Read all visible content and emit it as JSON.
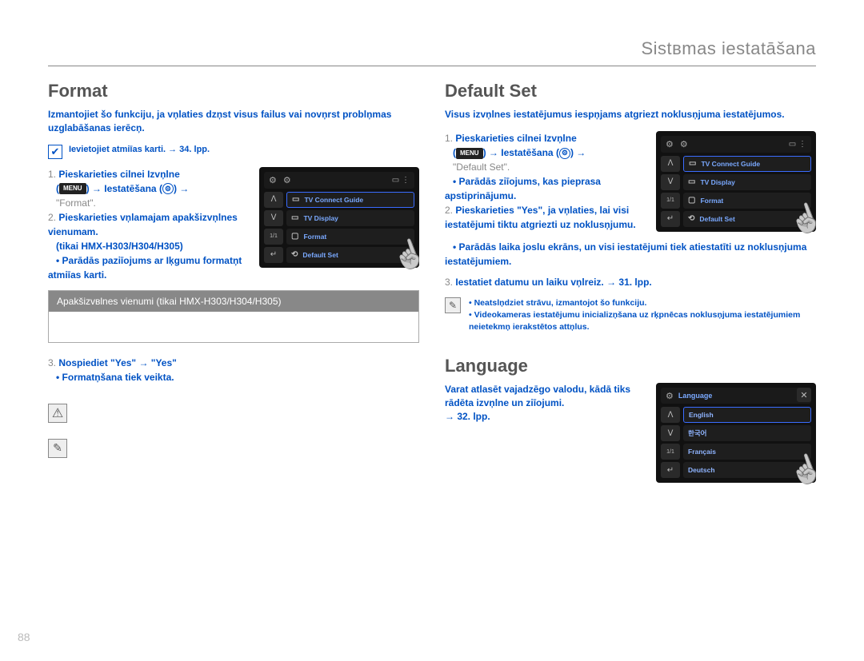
{
  "header": {
    "title": "Sistвmas iestatāšana"
  },
  "page_number": "88",
  "left": {
    "format": {
      "title": "Format",
      "intro": "Izmantojiet šo funkciju, ja vņlaties dzņst visus failus vai novņrst problņmas uzglabāšanas ierēcņ.",
      "precheck": "Ievietojiet atmiīas karti. → 34. lpp.",
      "step1_num": "1.",
      "step1": "Pieskarieties cilnei Izvņlne",
      "step1_b": "Iestatēšana (",
      "step1_c": ") →",
      "step1_format": "\"Format\".",
      "step2_num": "2.",
      "step2": "Pieskarieties vņlamajam apakšizvņlnes vienumam.",
      "step2_only": "(tikai HMX-H303/H304/H305)",
      "step2_li1": "Parādās paziīojums ar Iķgumu formatņt atmiīas karti.",
      "sub_header": "Apakšizvвlnes vienumi (tikai HMX-H303/H304/H305)",
      "step3_num": "3.",
      "step3": "Nospiediet \"Yes\" → \"Yes\"",
      "step3_li1": "Formatņšana tiek veikta."
    },
    "screen1": {
      "side": {
        "up": "ᐱ",
        "down": "ᐯ",
        "page": "1/1",
        "back": "↵"
      },
      "row1": "TV Connect Guide",
      "row2": "TV Display",
      "row3": "Format",
      "row4": "Default Set"
    }
  },
  "right": {
    "defset": {
      "title": "Default Set",
      "intro": "Visus izvņlnes iestatējumus iespņjams atgriezt noklusņjuma iestatējumos.",
      "step1_num": "1.",
      "step1": "Pieskarieties cilnei Izvņlne",
      "step1_b": "Iestatēšana (",
      "step1_c": ") →",
      "step1_item": "\"Default Set\".",
      "step1_li1": "Parādās ziīojums, kas pieprasa apstiprinājumu.",
      "step2_num": "2.",
      "step2": "Pieskarieties \"Yes\", ja vņlaties, lai visi iestatējumi tiktu atgriezti uz noklusņjumu.",
      "step2_li1": "Parādās laika joslu ekrāns, un visi iestatējumi tiek atiestatīti uz noklusņjuma iestatējumiem.",
      "step3_num": "3.",
      "step3": "Iestatiet datumu un laiku vņlreiz. → 31. lpp.",
      "note_li1": "Neatslņdziet strāvu, izmantojot šo funkciju.",
      "note_li2": "Videokameras iestatējumu inicializņšana uz rķpnēcas noklusņjuma iestatējumiem neietekmņ ierakstētos attņlus."
    },
    "screen2": {
      "side": {
        "up": "ᐱ",
        "down": "ᐯ",
        "page": "1/1",
        "back": "↵"
      },
      "row1": "TV Connect Guide",
      "row2": "TV Display",
      "row3": "Format",
      "row4": "Default Set"
    },
    "language": {
      "title": "Language",
      "intro": "Varat atlasēt vajadzēgo valodu, kādā tiks rādēta izvņlne un ziīojumi.",
      "ref": "→ 32. lpp."
    },
    "screen3": {
      "header_label": "Language",
      "side": {
        "up": "ᐱ",
        "down": "ᐯ",
        "page": "1/1",
        "back": "↵"
      },
      "row1": "English",
      "row2": "한국어",
      "row3": "Français",
      "row4": "Deutsch"
    }
  },
  "labels": {
    "menu": "MENU"
  }
}
